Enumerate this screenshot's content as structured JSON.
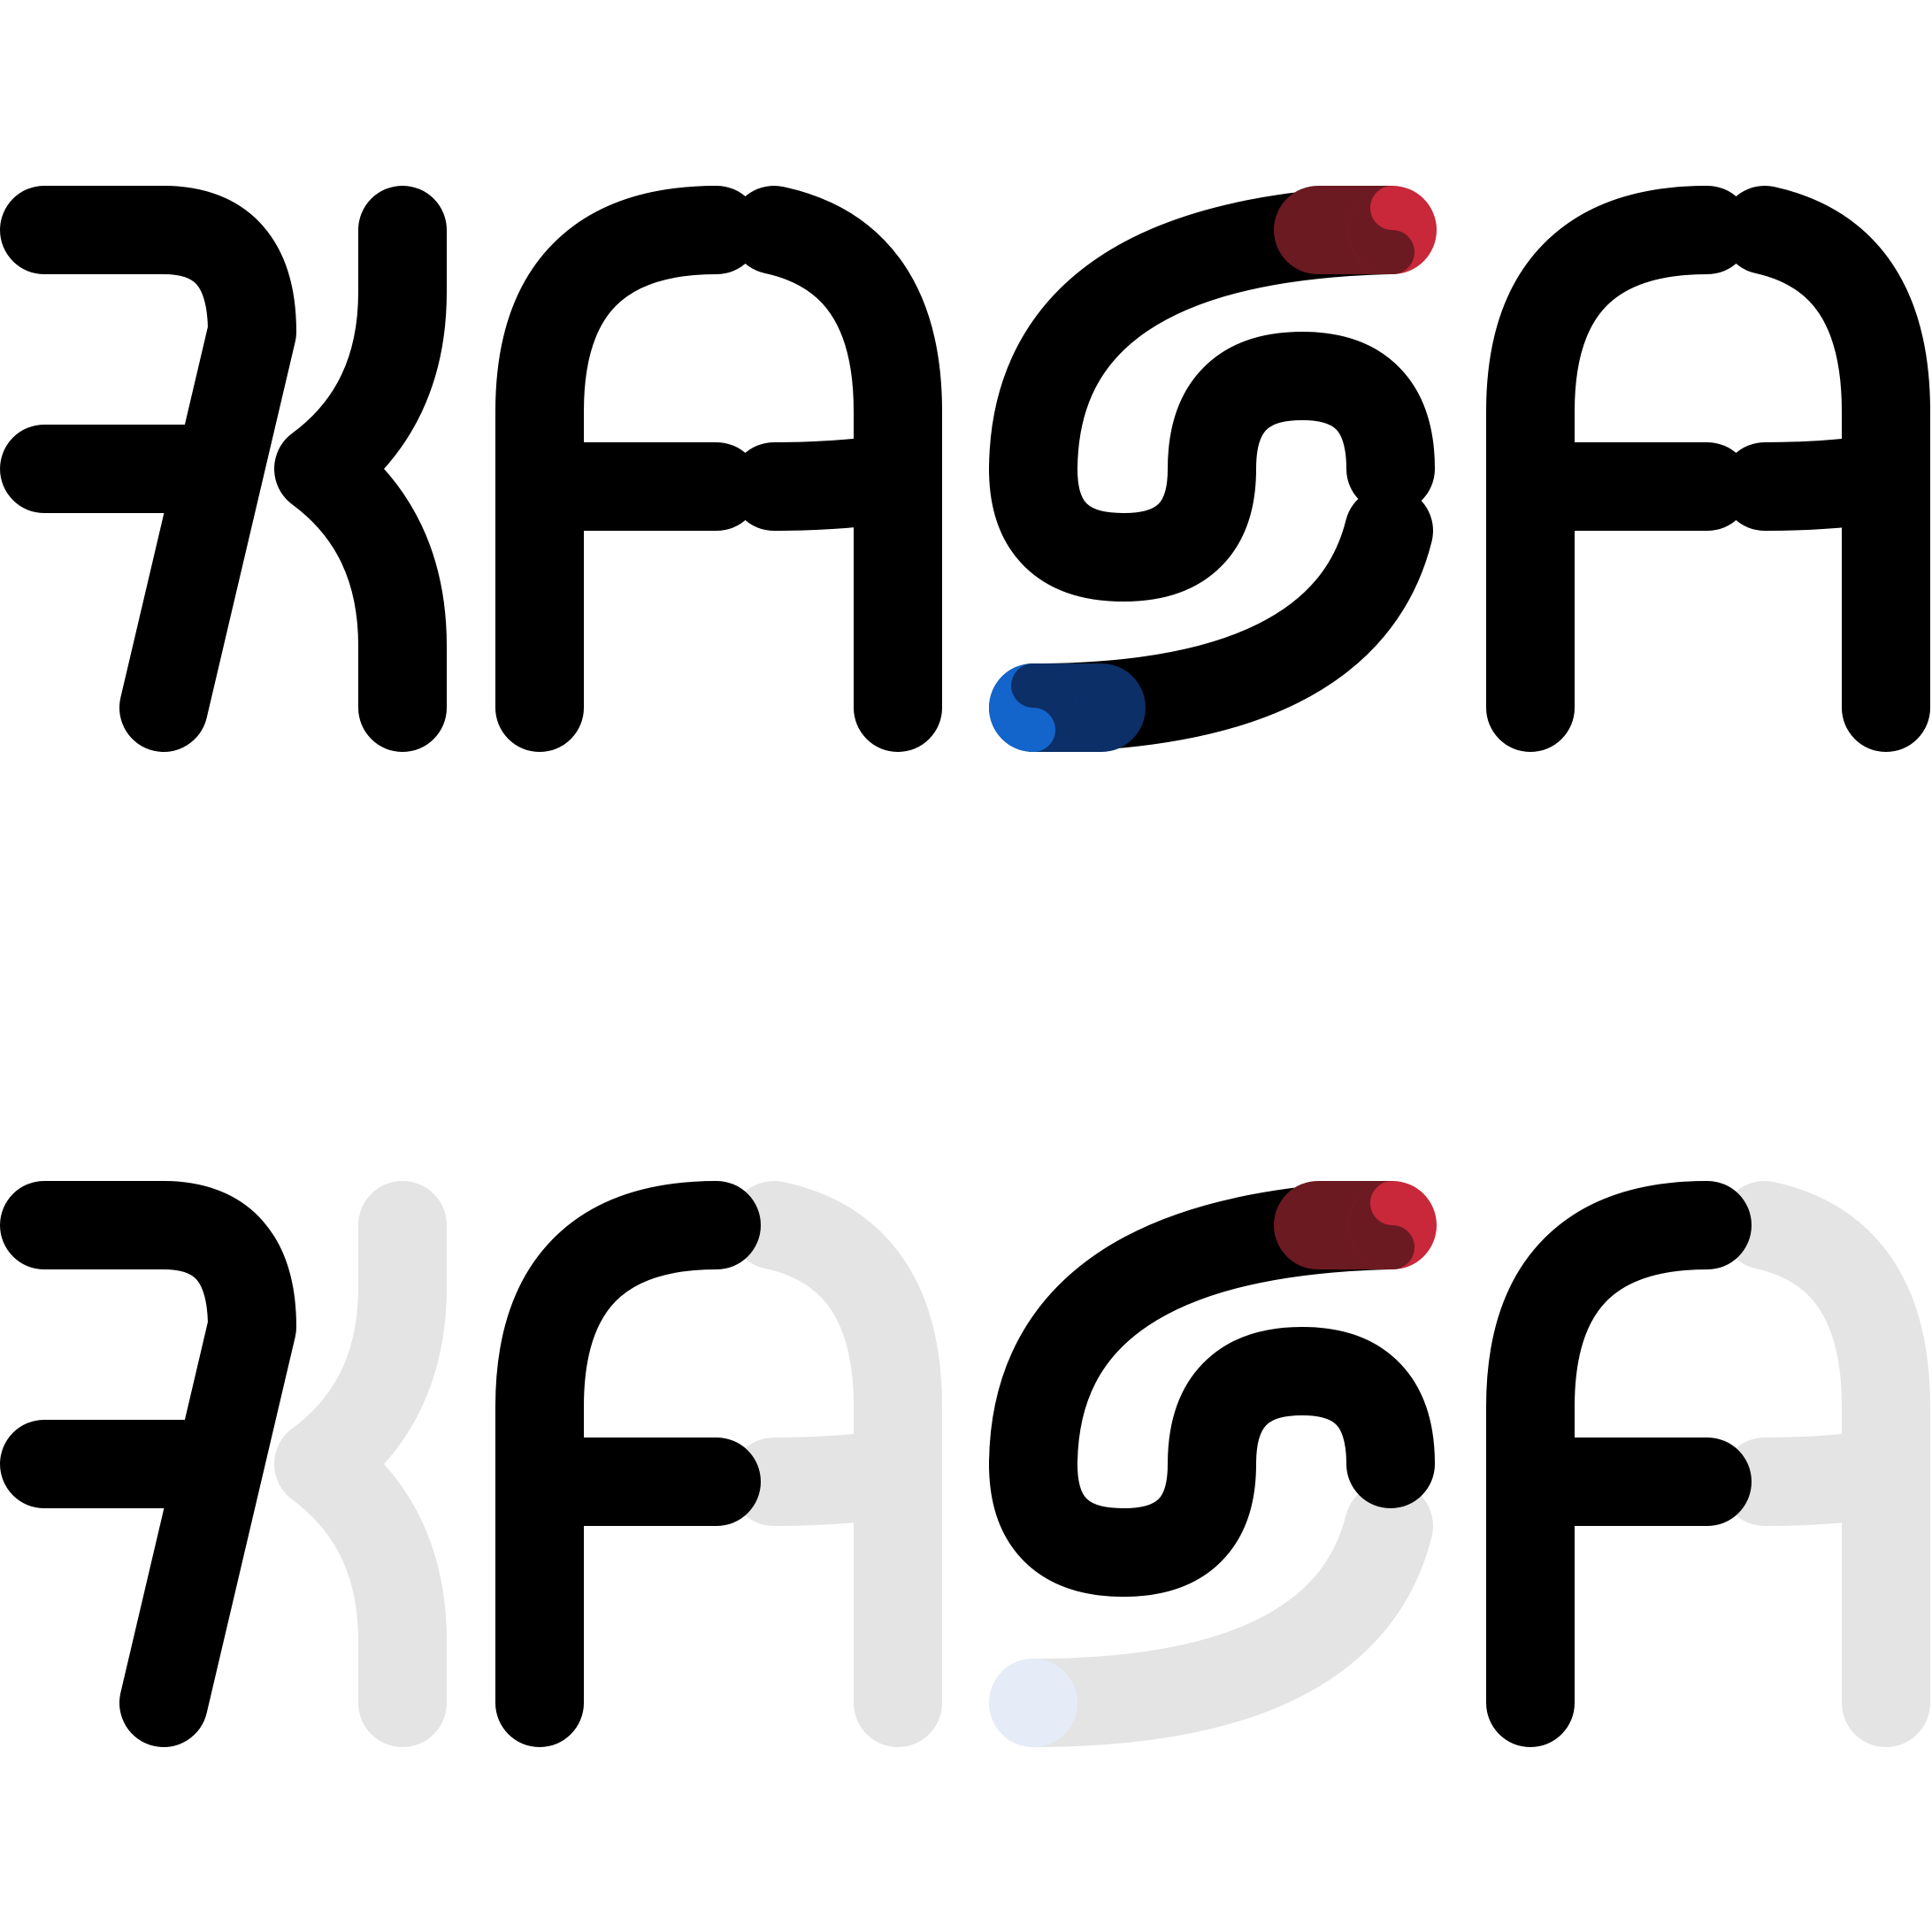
{
  "logos": [
    {
      "variant": "full",
      "wordmark": "KASA",
      "colors": {
        "stroke": "#000000",
        "accent_red": "#c8283a",
        "accent_red_dark": "#6b1a22",
        "accent_blue": "#1365cc",
        "accent_blue_dark": "#0b2f66"
      }
    },
    {
      "variant": "partial-highlight",
      "wordmark": "KASA",
      "colors": {
        "stroke": "#000000",
        "faded": "#e4e4e4",
        "accent_red": "#c8283a",
        "accent_red_dark": "#6b1a22",
        "accent_blue_faded": "#e5ecf7"
      }
    }
  ]
}
